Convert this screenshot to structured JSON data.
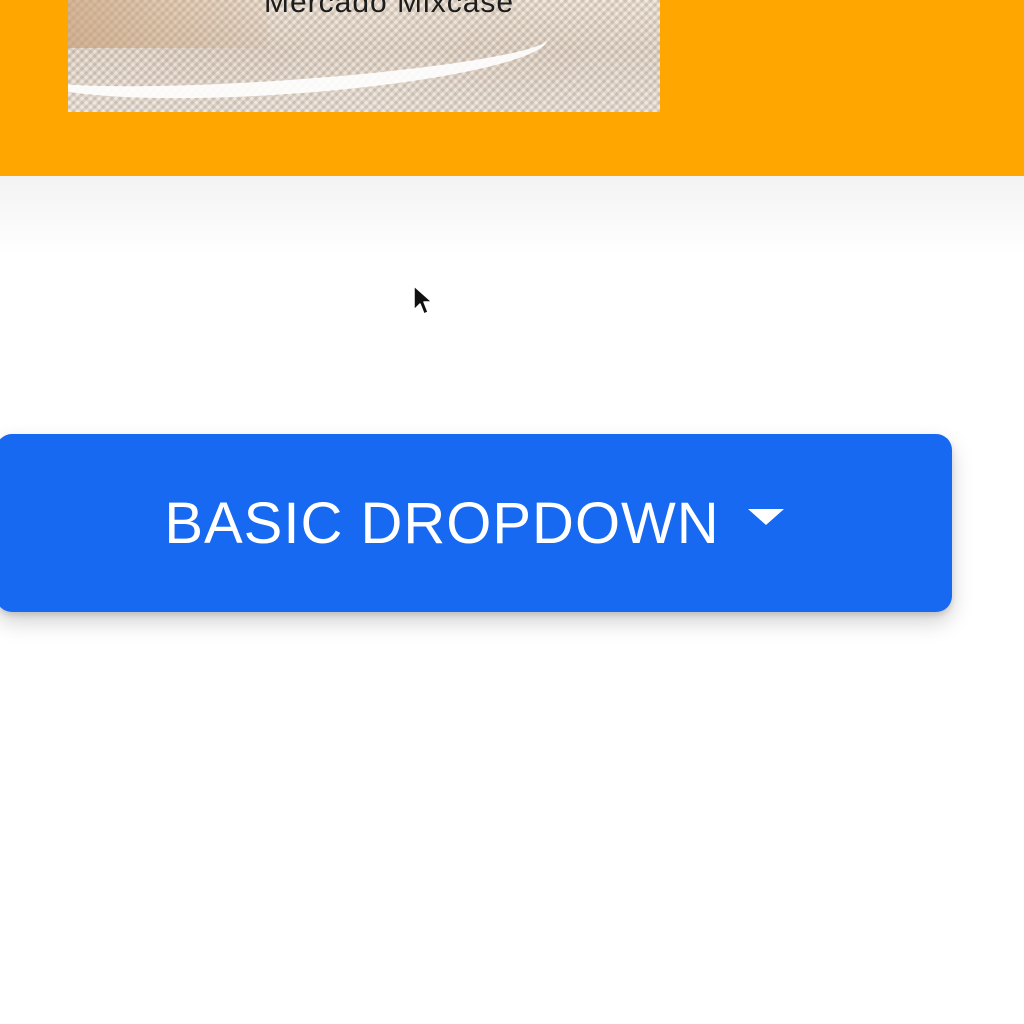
{
  "header": {
    "banner_caption": "Mercado Mixcase",
    "band_color": "#ffa600"
  },
  "dropdown": {
    "label": "BASIC DROPDOWN",
    "caret_icon": "caret-down-icon",
    "color": "#1669f0"
  },
  "cursor": {
    "icon": "mouse-pointer-icon"
  }
}
